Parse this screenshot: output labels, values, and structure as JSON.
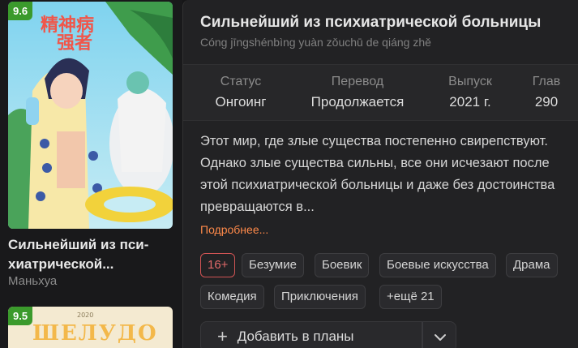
{
  "cards": [
    {
      "rating": "9.6",
      "title": "Сильнейший из пси-хиатрической...",
      "type": "Маньхуа",
      "cover_text": "精神病院强者"
    },
    {
      "rating": "9.5",
      "cover_text": "ШЕЛУДО",
      "cover_top": "2020"
    }
  ],
  "popup": {
    "title": "Сильнейший из психиатрической больницы",
    "subtitle": "Cóng jīngshénbìng yuàn zǒuchū de qiáng zhě",
    "stats": [
      {
        "label": "Статус",
        "value": "Онгоинг"
      },
      {
        "label": "Перевод",
        "value": "Продолжается"
      },
      {
        "label": "Выпуск",
        "value": "2021 г."
      },
      {
        "label": "Глав",
        "value": "290"
      }
    ],
    "description": "Этот мир, где злые существа постепенно свирепствуют. Однако злые существа сильны, все они исчезают после этой психиатрической больницы и даже без достоинства превращаются в...",
    "more_link": "Подробнее...",
    "tags": [
      "16+",
      "Безумие",
      "Боевик",
      "Боевые искусства",
      "Драма",
      "Комедия",
      "Приключения",
      "+ещё 21"
    ],
    "add_button": "Добавить в планы",
    "add_icon": "plus-icon",
    "dropdown_icon": "chevron-down-icon"
  },
  "colors": {
    "rating_badge": "#3b9a2c",
    "accent_link": "#ff8a4a",
    "age_tag": "#e36a6a"
  }
}
